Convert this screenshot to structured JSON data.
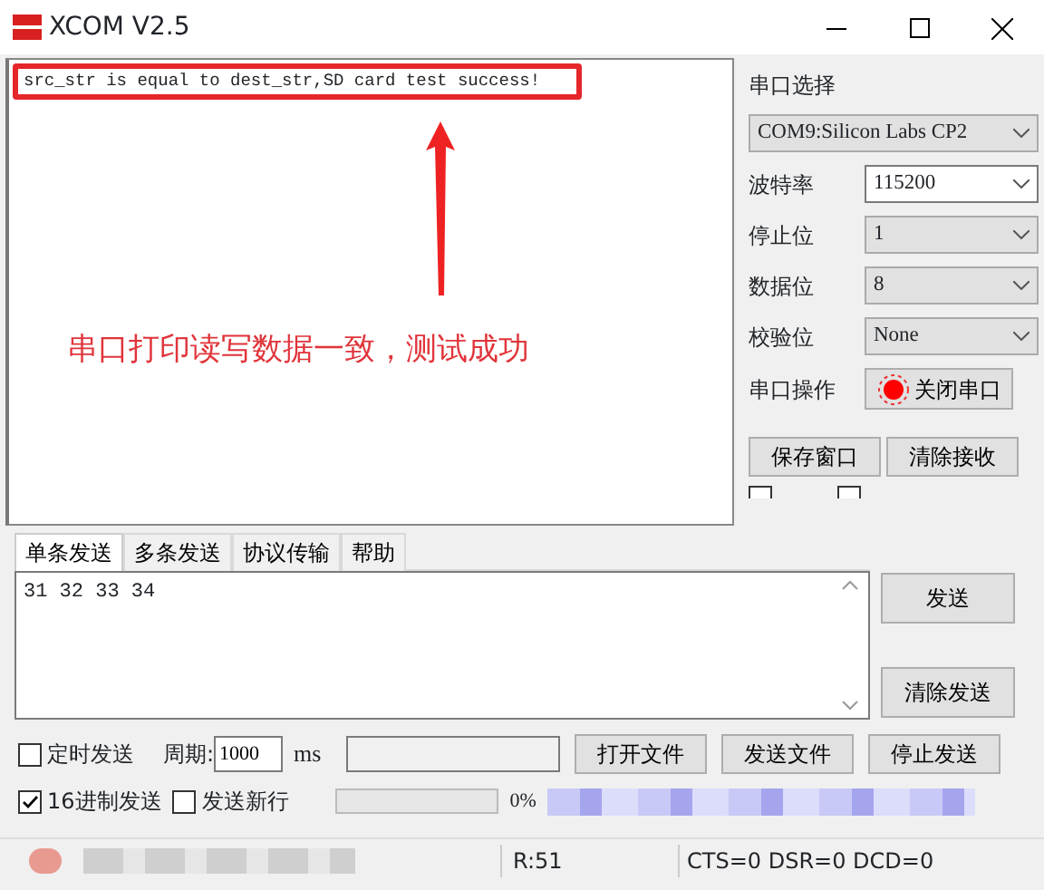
{
  "window": {
    "title": "XCOM V2.5"
  },
  "receive": {
    "text": "src_str is equal to dest_str,SD card test success!",
    "annotation": "串口打印读写数据一致，测试成功"
  },
  "port": {
    "label": "串口选择",
    "value": "COM9:Silicon Labs CP2",
    "disabled": true
  },
  "settings": [
    {
      "label": "波特率",
      "value": "115200",
      "disabled": false
    },
    {
      "label": "停止位",
      "value": "1",
      "disabled": true
    },
    {
      "label": "数据位",
      "value": "8",
      "disabled": true
    },
    {
      "label": "校验位",
      "value": "None",
      "disabled": true
    }
  ],
  "serial_op": {
    "label": "串口操作",
    "button": "关闭串口",
    "on": true
  },
  "receive_buttons": [
    "保存窗口",
    "清除接收"
  ],
  "display_options": [
    {
      "checked": false
    },
    {
      "checked": false
    }
  ],
  "tabs": [
    {
      "label": "单条发送",
      "selected": true
    },
    {
      "label": "多条发送",
      "selected": false
    },
    {
      "label": "协议传输",
      "selected": false
    },
    {
      "label": "帮助",
      "selected": false
    }
  ],
  "send": {
    "text": "31 32 33 34",
    "buttons": [
      "发送",
      "清除发送"
    ]
  },
  "timed": {
    "label": "定时发送",
    "checked": false,
    "period_label": "周期:",
    "period": "1000",
    "unit": "ms"
  },
  "file_buttons": [
    "打开文件",
    "发送文件",
    "停止发送"
  ],
  "options": [
    {
      "label": "16进制发送",
      "checked": true
    },
    {
      "label": "发送新行",
      "checked": false
    }
  ],
  "progress": {
    "level": 0,
    "reading": "0%"
  },
  "status_bar": {
    "received": "R:51",
    "lines": "CTS=0 DSR=0 DCD=0"
  }
}
